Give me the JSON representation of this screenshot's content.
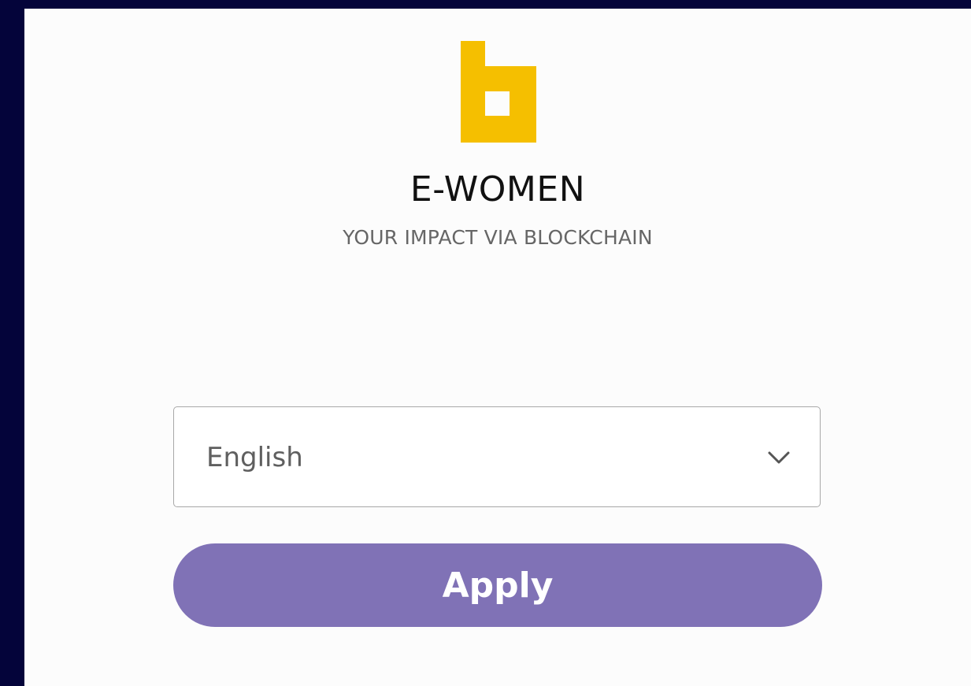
{
  "app": {
    "title": "E-WOMEN",
    "subtitle": "YOUR IMPACT VIA BLOCKCHAIN",
    "logo_icon": "e-women-logo",
    "logo_color": "#f5bf00"
  },
  "language_select": {
    "selected": "English",
    "icon": "chevron-down-icon"
  },
  "apply_button": {
    "label": "Apply",
    "color": "#8072b6"
  }
}
